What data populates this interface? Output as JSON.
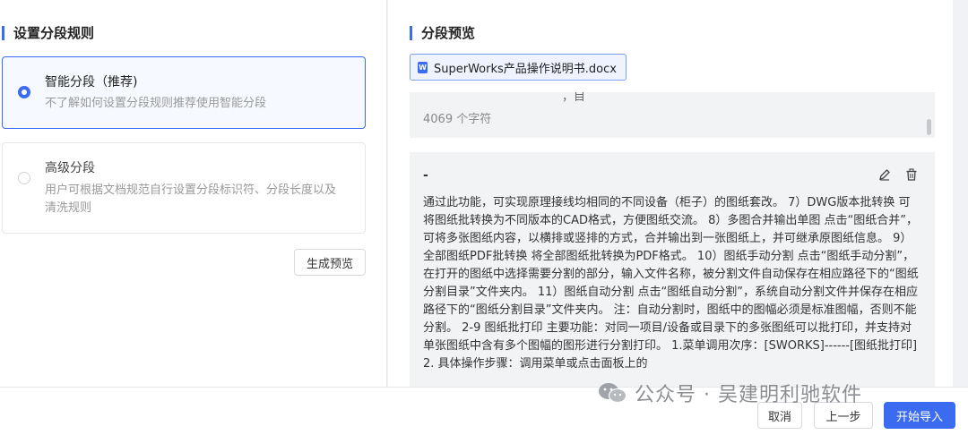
{
  "left": {
    "title": "设置分段规则",
    "options": [
      {
        "title": "智能分段（推荐)",
        "desc": "不了解如何设置分段规则推荐使用智能分段",
        "selected": true
      },
      {
        "title": "高级分段",
        "desc": "用户可根据文档规范自行设置分段标识符、分段长度以及清洗规则",
        "selected": false
      }
    ],
    "preview_button": "生成预览"
  },
  "right": {
    "title": "分段预览",
    "file_name": "SuperWorks产品操作说明书.docx",
    "file_icon_letter": "W",
    "segment1": {
      "clipped_text": "，目",
      "char_count": "4069 个字符"
    },
    "segment2": {
      "title": "-",
      "text": "通过此功能，可实现原理接线均相同的不同设备（柜子）的图纸套改。 7）DWG版本批转换 可将图纸批转换为不同版本的CAD格式，方便图纸交流。 8）多图合并输出单图 点击“图纸合并”，可将多张图纸内容，以横排或竖排的方式，合并输出到一张图纸上，并可继承原图纸信息。 9）全部图纸PDF批转换 将全部图纸批转换为PDF格式。 10）图纸手动分割 点击“图纸手动分割”，在打开的图纸中选择需要分割的部分，输入文件名称，被分割文件自动保存在相应路径下的“图纸分割目录”文件夹内。 11）图纸自动分割 点击“图纸自动分割”，系统自动分割文件并保存在相应路径下的“图纸分割目录”文件夹内。 注：自动分割时，图纸中的图幅必须是标准图幅，否则不能分割。 2-9 图纸批打印 主要功能：对同一项目/设备或目录下的多张图纸可以批打印，并支持对单张图纸中含有多个图幅的图形进行分割打印。 1.菜单调用次序：[SWORKS]------[图纸批打印] 2. 具体操作步骤：调用菜单或点击面板上的",
      "edit_icon": "pencil-icon",
      "delete_icon": "trash-icon"
    }
  },
  "footer": {
    "cancel": "取消",
    "prev": "上一步",
    "start": "开始导入"
  },
  "watermark": {
    "text": "公众号 · 吴建明利驰软件"
  },
  "colors": {
    "accent": "#3b6bf0",
    "panel_bg": "#ffffff",
    "segment_bg": "#f2f3f5"
  }
}
